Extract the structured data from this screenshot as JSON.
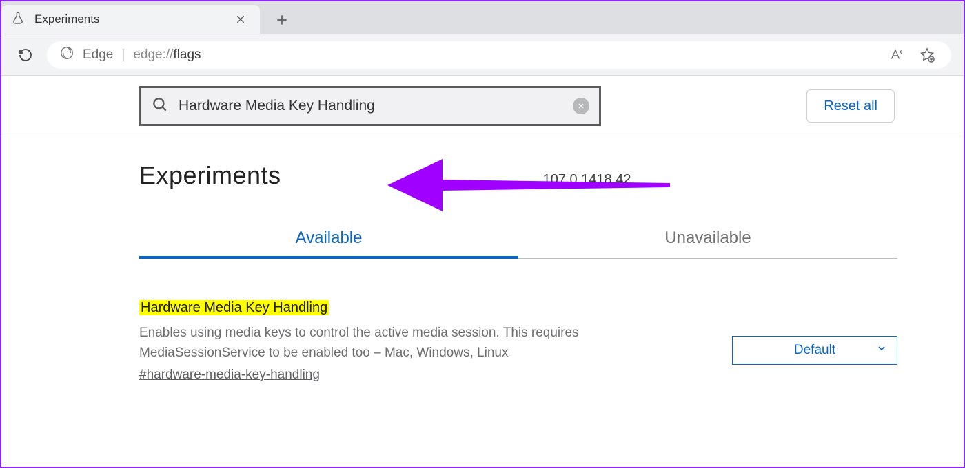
{
  "browser": {
    "tab_title": "Experiments",
    "address": {
      "brand": "Edge",
      "url_prefix": "edge://",
      "url_main": "flags"
    }
  },
  "search": {
    "value": "Hardware Media Key Handling"
  },
  "reset_label": "Reset all",
  "page_title": "Experiments",
  "version": "107.0.1418.42",
  "tabs": {
    "available": "Available",
    "unavailable": "Unavailable"
  },
  "flag": {
    "title": "Hardware Media Key Handling",
    "description": "Enables using media keys to control the active media session. This requires MediaSessionService to be enabled too – Mac, Windows, Linux",
    "anchor": "#hardware-media-key-handling",
    "select_value": "Default"
  }
}
